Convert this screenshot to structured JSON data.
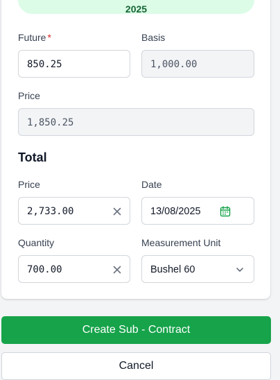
{
  "header": {
    "pill_text": "2025"
  },
  "form": {
    "future": {
      "label": "Future",
      "required_mark": "*",
      "value": "850.25"
    },
    "basis": {
      "label": "Basis",
      "value": "1,000.00"
    },
    "price": {
      "label": "Price",
      "value": "1,850.25"
    }
  },
  "total": {
    "title": "Total",
    "price": {
      "label": "Price",
      "value": "2,733.00"
    },
    "date": {
      "label": "Date",
      "value": "13/08/2025"
    },
    "quantity": {
      "label": "Quantity",
      "value": "700.00"
    },
    "measurement_unit": {
      "label": "Measurement Unit",
      "value": "Bushel 60"
    }
  },
  "actions": {
    "create_label": "Create Sub - Contract",
    "cancel_label": "Cancel"
  },
  "icons": {
    "clear": "close-icon",
    "calendar": "calendar-icon",
    "dropdown": "chevron-down-icon"
  },
  "colors": {
    "primary": "#16a34a",
    "pill_bg": "#dcfce7",
    "pill_text": "#166534",
    "required": "#dc2626",
    "calendar_icon": "#16a34a"
  }
}
